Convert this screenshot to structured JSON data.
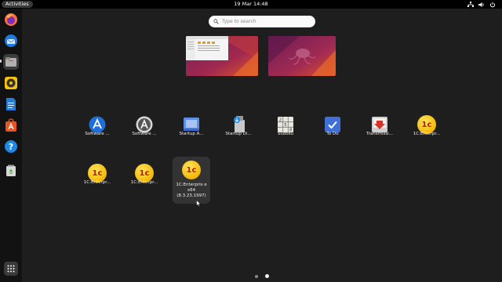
{
  "topbar": {
    "activities_label": "Activities",
    "clock": "19 Mar  14:48",
    "tray_icons": [
      "network-icon",
      "volume-icon",
      "power-icon"
    ]
  },
  "dock": {
    "items": [
      {
        "name": "firefox-icon"
      },
      {
        "name": "thunderbird-icon"
      },
      {
        "name": "files-icon",
        "active": true
      },
      {
        "name": "rhythmbox-icon"
      },
      {
        "name": "writer-icon"
      },
      {
        "name": "software-icon"
      },
      {
        "name": "help-icon"
      },
      {
        "name": "trash-icon"
      }
    ],
    "show_apps_icon": "grid-icon"
  },
  "search": {
    "placeholder": "Type to search"
  },
  "workspaces": [
    {
      "name": "workspace-1",
      "has_window": true
    },
    {
      "name": "workspace-2",
      "has_window": false
    }
  ],
  "apps": [
    {
      "label": "Software ...",
      "icon": "software-store-icon"
    },
    {
      "label": "Software ...",
      "icon": "software-updater-icon"
    },
    {
      "label": "Startup A...",
      "icon": "startup-apps-icon"
    },
    {
      "label": "Startup Di...",
      "icon": "startup-disk-icon"
    },
    {
      "label": "Sudoku",
      "icon": "sudoku-icon"
    },
    {
      "label": "To Do",
      "icon": "todo-icon"
    },
    {
      "label": "Transmissi...",
      "icon": "transmission-icon"
    },
    {
      "label": "1C:Enterpr...",
      "icon": "onec-icon"
    },
    {
      "label": "1C:Enterpr...",
      "icon": "onec-icon"
    },
    {
      "label": "1C:Enterpr...",
      "icon": "onec-icon"
    },
    {
      "label": "1C:Enterpris e x64 (8.3.23.1997)",
      "icon": "onec-icon",
      "selected": true
    }
  ],
  "colors": {
    "ubuntu_orange": "#e95420",
    "wallpaper_purple": "#5b1e4f",
    "onec_yellow": "#f2b705",
    "onec_red": "#c0161b"
  },
  "pagination": {
    "pages": 2,
    "current": 2
  }
}
